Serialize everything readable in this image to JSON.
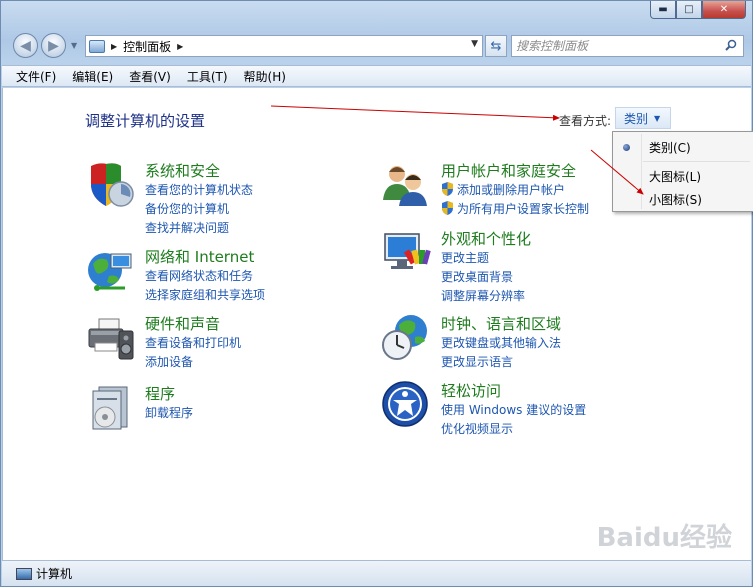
{
  "window": {
    "min_glyph": "▬",
    "max_glyph": "□",
    "close_glyph": "✕"
  },
  "address": {
    "path": "控制面板",
    "search_placeholder": "搜索控制面板"
  },
  "menu": [
    "文件(F)",
    "编辑(E)",
    "查看(V)",
    "工具(T)",
    "帮助(H)"
  ],
  "main": {
    "title": "调整计算机的设置",
    "view_by_label": "查看方式:",
    "view_by_value": "类别",
    "view_options": [
      "类别(C)",
      "大图标(L)",
      "小图标(S)"
    ],
    "selected_option": "类别(C)"
  },
  "categories": [
    {
      "title": "系统和安全",
      "links": [
        "查看您的计算机状态",
        "备份您的计算机",
        "查找并解决问题"
      ],
      "icon": "shield-icon"
    },
    {
      "title": "网络和 Internet",
      "links": [
        "查看网络状态和任务",
        "选择家庭组和共享选项"
      ],
      "icon": "network-globe-icon"
    },
    {
      "title": "硬件和声音",
      "links": [
        "查看设备和打印机",
        "添加设备"
      ],
      "icon": "printer-icon"
    },
    {
      "title": "程序",
      "links": [
        "卸载程序"
      ],
      "icon": "programs-icon"
    },
    {
      "title": "用户帐户和家庭安全",
      "links": [
        "添加或删除用户帐户",
        "为所有用户设置家长控制"
      ],
      "icon": "users-icon"
    },
    {
      "title": "外观和个性化",
      "links": [
        "更改主题",
        "更改桌面背景",
        "调整屏幕分辨率"
      ],
      "icon": "monitor-paint-icon"
    },
    {
      "title": "时钟、语言和区域",
      "links": [
        "更改键盘或其他输入法",
        "更改显示语言"
      ],
      "icon": "clock-globe-icon"
    },
    {
      "title": "轻松访问",
      "links": [
        "使用 Windows 建议的设置",
        "优化视频显示"
      ],
      "icon": "ease-of-access-icon"
    }
  ],
  "status": {
    "text": "计算机"
  },
  "watermark": "Baidu经验",
  "colors": {
    "title_green": "#1e7c1e",
    "link_blue": "#1e57b0",
    "annotation_red": "#cc0000"
  }
}
